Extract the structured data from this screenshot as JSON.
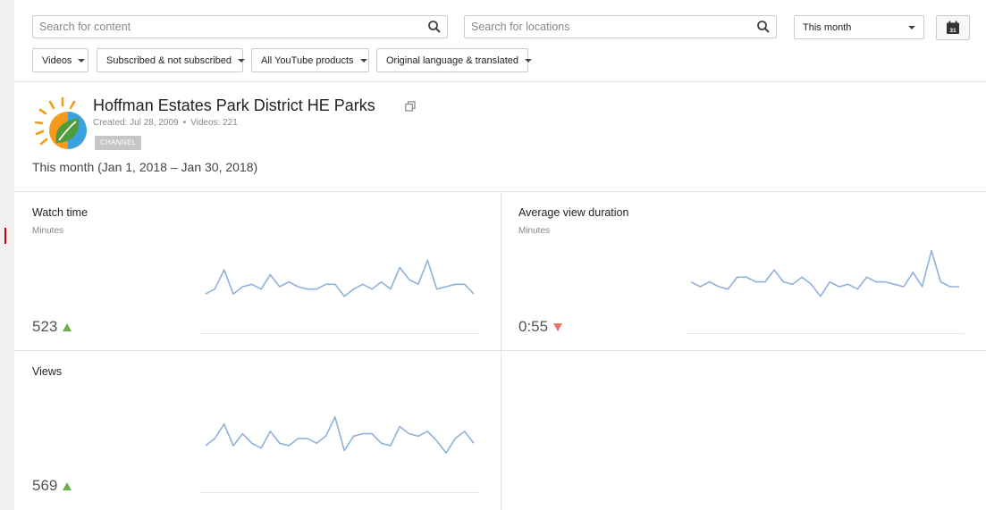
{
  "filters": {
    "content_search_placeholder": "Search for content",
    "location_search_placeholder": "Search for locations",
    "date_range": "This month",
    "calendar_day": "31",
    "chips": [
      {
        "label": "Videos"
      },
      {
        "label": "Subscribed & not subscribed"
      },
      {
        "label": "All YouTube products"
      },
      {
        "label": "Original language & translated"
      }
    ]
  },
  "channel": {
    "title": "Hoffman Estates Park District HE Parks",
    "created": "Created: Jul 28, 2009",
    "videos": "Videos: 221",
    "badge": "CHANNEL",
    "period": "This month (Jan 1, 2018 – Jan 30, 2018)"
  },
  "colors": {
    "sparkline": "#8fb1dc",
    "trend_up": "#6ab04c",
    "trend_down": "#e8756e",
    "logo_orange": "#f59a1b",
    "logo_blue": "#3aa3df",
    "logo_green": "#4f9d3a"
  },
  "icons": {
    "search": "search-icon",
    "calendar": "calendar-icon",
    "external": "external-link-icon",
    "trend_up": "trend-up-icon",
    "trend_down": "trend-down-icon"
  },
  "metrics": [
    {
      "title": "Watch time",
      "unit": "Minutes",
      "value": "523",
      "trend": "up",
      "series": [
        13,
        15,
        23,
        13,
        16,
        17,
        15,
        21,
        16,
        18,
        16,
        15,
        15,
        17,
        17,
        12,
        15,
        17,
        15,
        18,
        15,
        24,
        19,
        17,
        27,
        15,
        16,
        17,
        17,
        13
      ]
    },
    {
      "title": "Average view duration",
      "unit": "Minutes",
      "value": "0:55",
      "trend": "down",
      "series": [
        18,
        16,
        18,
        16,
        15,
        20,
        20,
        18,
        18,
        23,
        18,
        17,
        20,
        17,
        12,
        18,
        16,
        17,
        15,
        20,
        18,
        18,
        17,
        16,
        22,
        16,
        31,
        18,
        16,
        16
      ]
    },
    {
      "title": "Views",
      "unit": "",
      "value": "569",
      "trend": "up",
      "series": [
        16,
        19,
        25,
        16,
        21,
        17,
        15,
        22,
        17,
        16,
        19,
        19,
        17,
        20,
        28,
        14,
        20,
        21,
        21,
        17,
        16,
        24,
        21,
        20,
        22,
        18,
        13,
        19,
        22,
        17
      ]
    }
  ]
}
